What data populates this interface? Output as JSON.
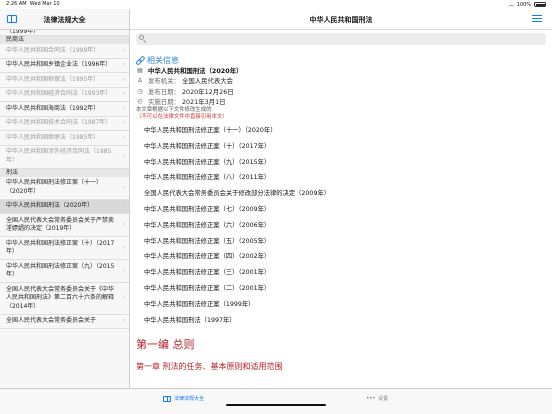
{
  "statusbar": {
    "time": "2:26 AM",
    "date": "Wed Mar 10",
    "battery": "100%"
  },
  "sidebar": {
    "title": "法律法规大全",
    "partial_top": "（1999年）",
    "sections": [
      {
        "header": "民商法",
        "items": [
          {
            "label": "中华人民共和国合同法（1999年）",
            "dim": true
          },
          {
            "label": "中华人民共和国乡镇企业法（1996年）",
            "dim": false
          },
          {
            "label": "中华人民共和国担保法（1995年）",
            "dim": true
          },
          {
            "label": "中华人民共和国经济合同法（1993年）",
            "dim": true
          },
          {
            "label": "中华人民共和国海商法（1992年）",
            "dim": false
          },
          {
            "label": "中华人民共和国技术合同法（1987年）",
            "dim": true
          },
          {
            "label": "中华人民共和国继承法（1985年）",
            "dim": true
          },
          {
            "label": "中华人民共和国涉外经济合同法（1985年）",
            "dim": true
          }
        ]
      },
      {
        "header": "刑法",
        "items": [
          {
            "label": "中华人民共和国刑法修正案（十一）（2020年）",
            "dim": false
          },
          {
            "label": "中华人民共和国刑法（2020年）",
            "dim": false,
            "selected": true
          },
          {
            "label": "全国人民代表大会常务委员会关于严禁卖淫嫖娼的决定（2019年）",
            "dim": false
          },
          {
            "label": "中华人民共和国刑法修正案（十）（2017年）",
            "dim": false
          },
          {
            "label": "中华人民共和国刑法修正案（九）（2015年）",
            "dim": false
          },
          {
            "label": "全国人民代表大会常务委员会关于《中华人民共和国刑法》第二百六十六条的解释（2014年）",
            "dim": false
          },
          {
            "label": "全国人民代表大会常务委员会关于",
            "dim": false
          }
        ]
      }
    ]
  },
  "main": {
    "title": "中华人民共和国刑法",
    "related_title": "相关信息",
    "law_name": "中华人民共和国刑法（2020年）",
    "issuer_label": "发布机关：",
    "issuer": "全国人民代表大会",
    "pub_date_label": "发布日期：",
    "pub_date": "2020年12月26日",
    "eff_date_label": "实施日期：",
    "eff_date": "2021年3月1日",
    "note": "本文章根据以下文件修改生成的",
    "warning": "（不可以在法律文件中直接引用本文）",
    "related": [
      "中华人民共和国刑法修正案（十一）（2020年）",
      "中华人民共和国刑法修正案（十）（2017年）",
      "中华人民共和国刑法修正案（九）（2015年）",
      "中华人民共和国刑法修正案（八）（2011年）",
      "全国人民代表大会常务委员会关于修改部分法律的决定（2009年）",
      "中华人民共和国刑法修正案（七）（2009年）",
      "中华人民共和国刑法修正案（六）（2006年）",
      "中华人民共和国刑法修正案（五）（2005年）",
      "中华人民共和国刑法修正案（四）（2002年）",
      "中华人民共和国刑法修正案（三）（2001年）",
      "中华人民共和国刑法修正案（二）（2001年）",
      "中华人民共和国刑法修正案（1999年）",
      "中华人民共和国刑法（1997年）"
    ],
    "part_title": "第一编 总则",
    "chapter_title": "第一章 刑法的任务、基本原则和适用范围"
  },
  "tabbar": {
    "law_tab": "法律法规大全",
    "settings_tab": "设置"
  },
  "colors": {
    "accent": "#0a7aff",
    "heading_red": "#b4212a",
    "link_blue": "#2f87d6",
    "warning_red": "#d0342c"
  },
  "icons": {
    "sidebar_toggle": "sidebar-toggle-icon",
    "menu": "menu-icon",
    "search": "search-icon",
    "link": "link-icon",
    "issuer": "person-icon",
    "calendar": "calendar-icon",
    "clock": "clock-icon",
    "book": "book-icon",
    "more": "more-icon"
  }
}
